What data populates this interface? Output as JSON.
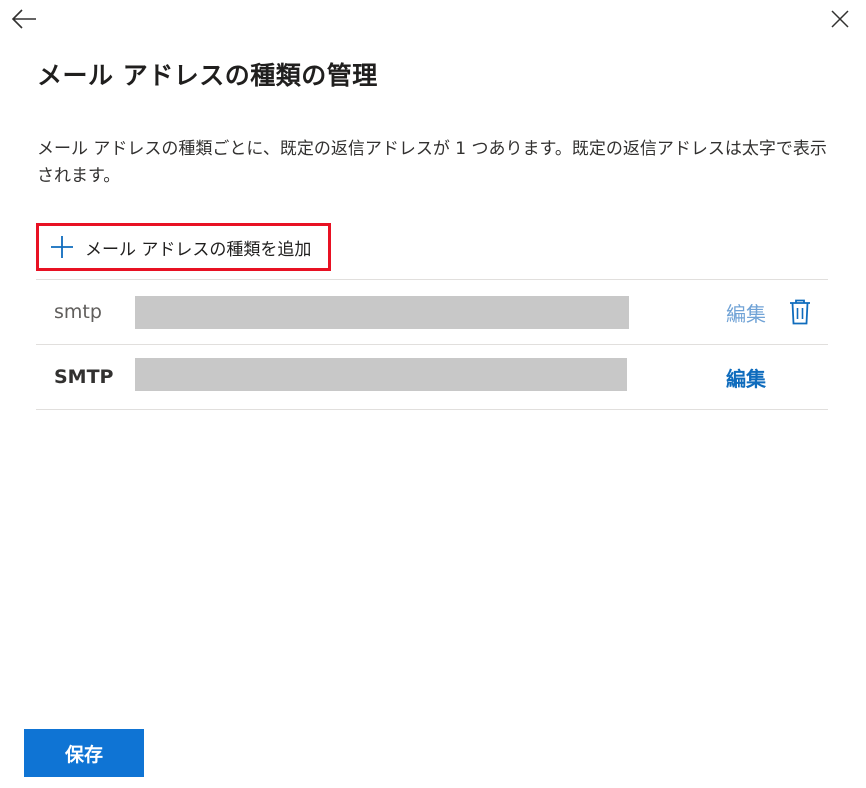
{
  "panel": {
    "title": "メール アドレスの種類の管理",
    "description": "メール アドレスの種類ごとに、既定の返信アドレスが 1 つあります。既定の返信アドレスは太字で表示されます。",
    "add_button_label": "メール アドレスの種類を追加"
  },
  "rows": [
    {
      "type": "smtp",
      "edit_label": "編集",
      "is_default": false
    },
    {
      "type": "SMTP",
      "edit_label": "編集",
      "is_default": true
    }
  ],
  "footer": {
    "save_label": "保存"
  },
  "icons": {
    "back": "arrow-left-icon",
    "close": "close-icon",
    "add": "plus-icon",
    "delete": "trash-icon"
  },
  "colors": {
    "accent": "#0f74d4",
    "highlight_border": "#e81123",
    "redacted": "#c8c8c8"
  }
}
